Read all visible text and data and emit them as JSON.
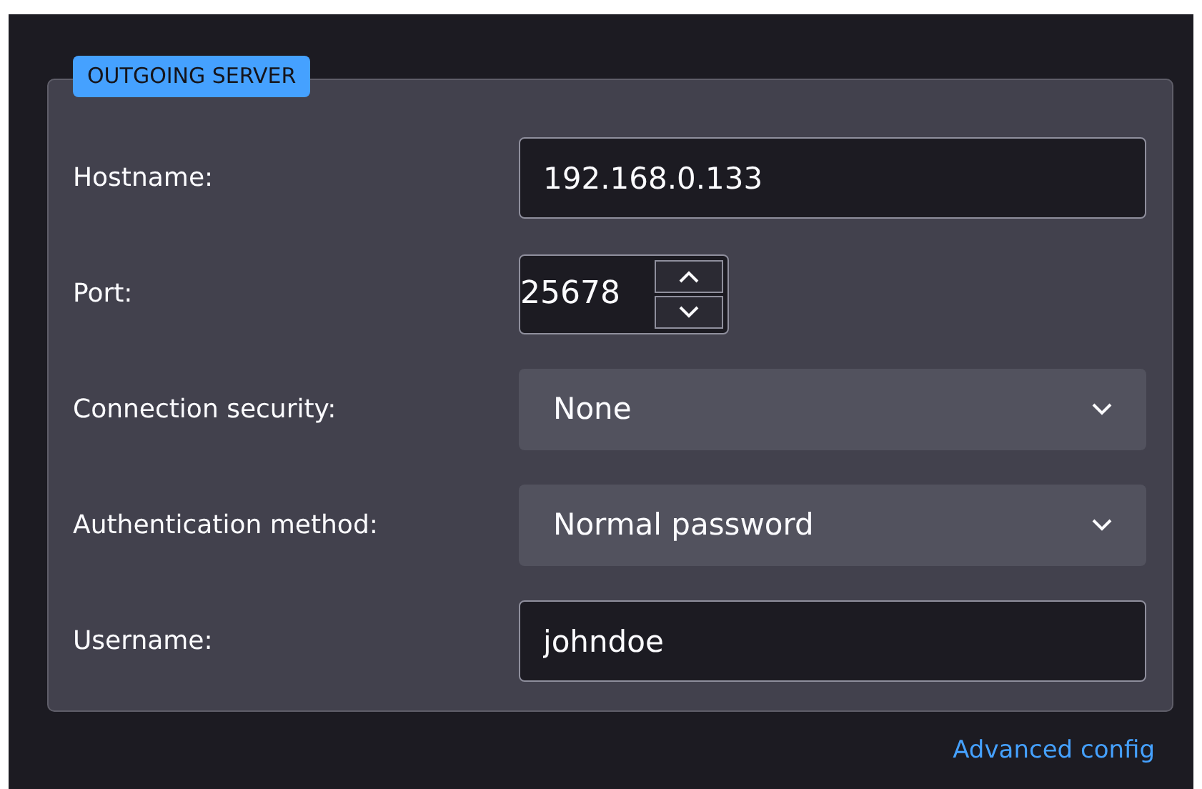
{
  "section": {
    "legend": "OUTGOING SERVER"
  },
  "fields": [
    {
      "kind": "text",
      "label": "Hostname:",
      "value": "192.168.0.133"
    },
    {
      "kind": "number",
      "label": "Port:",
      "value": "25678"
    },
    {
      "kind": "select",
      "label": "Connection security:",
      "value": "None"
    },
    {
      "kind": "select",
      "label": "Authentication method:",
      "value": "Normal password"
    },
    {
      "kind": "text",
      "label": "Username:",
      "value": "johndoe"
    }
  ],
  "link": "Advanced config"
}
